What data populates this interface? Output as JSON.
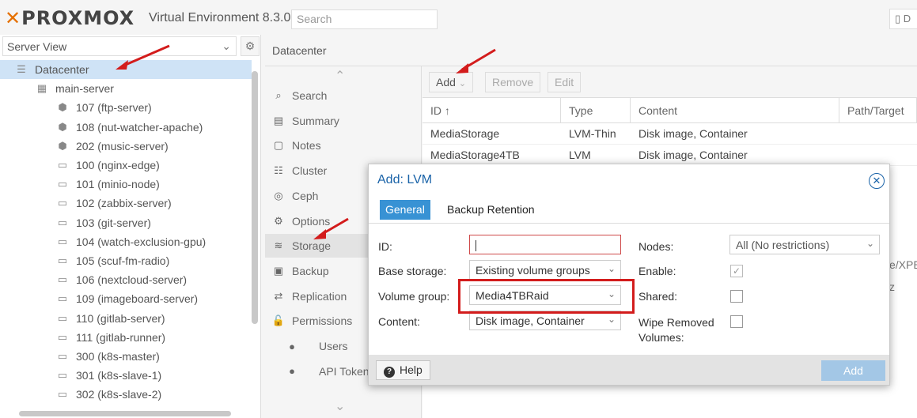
{
  "topbar": {
    "brand_left": "✕",
    "brand_name": "PROXMOX",
    "version": "Virtual Environment 8.3.0",
    "search_placeholder": "Search",
    "docs_label": "D"
  },
  "left_panel": {
    "view_select": "Server View",
    "tree": [
      {
        "label": "Datacenter",
        "icon": "server-stack-icon",
        "level": 0,
        "selected": true
      },
      {
        "label": "main-server",
        "icon": "node-online-icon",
        "level": 1
      },
      {
        "label": "107 (ftp-server)",
        "icon": "container-running-icon",
        "level": 2
      },
      {
        "label": "108 (nut-watcher-apache)",
        "icon": "container-running-icon",
        "level": 2
      },
      {
        "label": "202 (music-server)",
        "icon": "container-running-icon",
        "level": 2
      },
      {
        "label": "100 (nginx-edge)",
        "icon": "vm-running-icon",
        "level": 2
      },
      {
        "label": "101 (minio-node)",
        "icon": "vm-running-icon",
        "level": 2
      },
      {
        "label": "102 (zabbix-server)",
        "icon": "vm-running-icon",
        "level": 2
      },
      {
        "label": "103 (git-server)",
        "icon": "vm-running-icon",
        "level": 2
      },
      {
        "label": "104 (watch-exclusion-gpu)",
        "icon": "vm-running-icon",
        "level": 2
      },
      {
        "label": "105 (scuf-fm-radio)",
        "icon": "vm-running-icon",
        "level": 2
      },
      {
        "label": "106 (nextcloud-server)",
        "icon": "vm-running-icon",
        "level": 2
      },
      {
        "label": "109 (imageboard-server)",
        "icon": "vm-running-icon",
        "level": 2
      },
      {
        "label": "110 (gitlab-server)",
        "icon": "vm-running-icon",
        "level": 2
      },
      {
        "label": "111 (gitlab-runner)",
        "icon": "vm-running-icon",
        "level": 2
      },
      {
        "label": "300 (k8s-master)",
        "icon": "vm-running-icon",
        "level": 2
      },
      {
        "label": "301 (k8s-slave-1)",
        "icon": "vm-running-icon",
        "level": 2
      },
      {
        "label": "302 (k8s-slave-2)",
        "icon": "vm-running-icon",
        "level": 2
      }
    ]
  },
  "breadcrumb": "Datacenter",
  "menu": [
    {
      "label": "Search",
      "icon": "search-icon"
    },
    {
      "label": "Summary",
      "icon": "book-icon"
    },
    {
      "label": "Notes",
      "icon": "notes-icon"
    },
    {
      "label": "Cluster",
      "icon": "cluster-icon"
    },
    {
      "label": "Ceph",
      "icon": "ceph-icon"
    },
    {
      "label": "Options",
      "icon": "gear-icon"
    },
    {
      "label": "Storage",
      "icon": "database-icon",
      "selected": true
    },
    {
      "label": "Backup",
      "icon": "floppy-icon"
    },
    {
      "label": "Replication",
      "icon": "retweet-icon"
    },
    {
      "label": "Permissions",
      "icon": "unlock-icon"
    },
    {
      "label": "Users",
      "icon": "user-icon",
      "sub": true
    },
    {
      "label": "API Tokens",
      "icon": "user-icon",
      "sub": true
    }
  ],
  "toolbar": {
    "add": "Add",
    "remove": "Remove",
    "edit": "Edit"
  },
  "grid": {
    "headers": [
      "ID ↑",
      "Type",
      "Content",
      "Path/Target"
    ],
    "rows": [
      [
        "MediaStorage",
        "LVM-Thin",
        "Disk image, Container",
        ""
      ],
      [
        "MediaStorage4TB",
        "LVM",
        "Disk image, Container",
        ""
      ]
    ],
    "peek_texts": [
      "e/XPE",
      "z"
    ]
  },
  "dialog": {
    "title": "Add: LVM",
    "tabs": [
      "General",
      "Backup Retention"
    ],
    "labels": {
      "id": "ID:",
      "base_storage": "Base storage:",
      "volume_group": "Volume group:",
      "content": "Content:",
      "nodes": "Nodes:",
      "enable": "Enable:",
      "shared": "Shared:",
      "wipe_line1": "Wipe Removed",
      "wipe_line2": "Volumes:"
    },
    "values": {
      "id": "",
      "base_storage": "Existing volume groups",
      "volume_group": "Media4TBRaid",
      "content": "Disk image, Container",
      "nodes": "All (No restrictions)",
      "enable": true,
      "shared": false,
      "wipe": false
    },
    "help": "Help",
    "add": "Add"
  },
  "colors": {
    "accent": "#3892d4",
    "brand": "#e57000",
    "annotation": "#d31c1c"
  }
}
